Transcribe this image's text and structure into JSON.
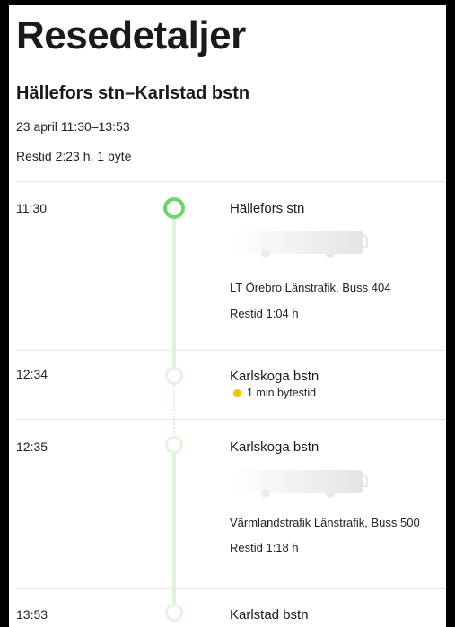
{
  "header": {
    "title": "Resedetaljer",
    "route": "Hällefors stn–Karlstad bstn",
    "date": "23 april 11:30–13:53",
    "travel_summary": "Restid 2:23 h, 1 byte"
  },
  "legs": [
    {
      "time": "11:30",
      "stop": "Hällefors stn",
      "operator": "LT Örebro Länstrafik, Buss 404",
      "duration": "Restid 1:04 h",
      "vehicle_icon": "bus-icon"
    },
    {
      "time": "12:34",
      "stop": "Karlskoga bstn",
      "transfer": "1 min bytestid"
    },
    {
      "time": "12:35",
      "stop": "Karlskoga bstn",
      "operator": "Värmlandstrafik Länstrafik, Buss 500",
      "duration": "Restid 1:18 h",
      "vehicle_icon": "bus-icon"
    },
    {
      "time": "13:53",
      "stop": "Karlstad bstn"
    }
  ],
  "colors": {
    "timeline_start": "#6cd66a",
    "timeline_line": "#dff2dc",
    "transfer_dot": "#f5c400"
  }
}
